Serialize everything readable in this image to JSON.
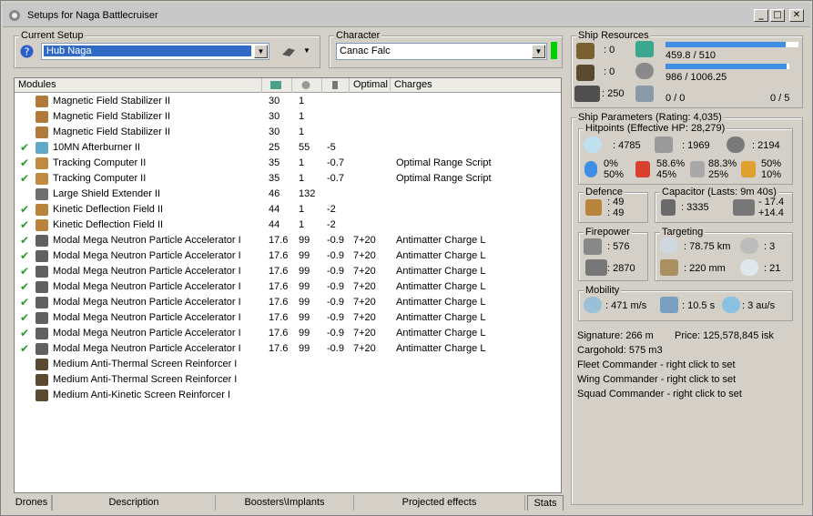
{
  "window": {
    "title": "Setups for Naga Battlecruiser",
    "min": "_",
    "max": "□",
    "close": "✕"
  },
  "setup": {
    "legend": "Current Setup",
    "value": "Hub Naga"
  },
  "character": {
    "legend": "Character",
    "value": "Canac Falc",
    "status_color": "#00d000"
  },
  "columns": {
    "modules": "Modules",
    "optimal": "Optimal",
    "charges": "Charges"
  },
  "modules": [
    {
      "check": "",
      "name": "Magnetic Field Stabilizer II",
      "cpu": "30",
      "pg": "1",
      "cap": "",
      "opt": "",
      "charge": "",
      "icon": "#b07a3a"
    },
    {
      "check": "",
      "name": "Magnetic Field Stabilizer II",
      "cpu": "30",
      "pg": "1",
      "cap": "",
      "opt": "",
      "charge": "",
      "icon": "#b07a3a"
    },
    {
      "check": "",
      "name": "Magnetic Field Stabilizer II",
      "cpu": "30",
      "pg": "1",
      "cap": "",
      "opt": "",
      "charge": "",
      "icon": "#b07a3a"
    },
    {
      "check": "✔",
      "name": "10MN Afterburner II",
      "cpu": "25",
      "pg": "55",
      "cap": "-5",
      "opt": "",
      "charge": "",
      "icon": "#5fa8c8"
    },
    {
      "check": "✔",
      "name": "Tracking Computer II",
      "cpu": "35",
      "pg": "1",
      "cap": "-0.7",
      "opt": "",
      "charge": "Optimal Range Script",
      "icon": "#c08a40"
    },
    {
      "check": "✔",
      "name": "Tracking Computer II",
      "cpu": "35",
      "pg": "1",
      "cap": "-0.7",
      "opt": "",
      "charge": "Optimal Range Script",
      "icon": "#c08a40"
    },
    {
      "check": "",
      "name": "Large Shield Extender II",
      "cpu": "46",
      "pg": "132",
      "cap": "",
      "opt": "",
      "charge": "",
      "icon": "#707070"
    },
    {
      "check": "✔",
      "name": "Kinetic Deflection Field II",
      "cpu": "44",
      "pg": "1",
      "cap": "-2",
      "opt": "",
      "charge": "",
      "icon": "#b8843c"
    },
    {
      "check": "✔",
      "name": "Kinetic Deflection Field II",
      "cpu": "44",
      "pg": "1",
      "cap": "-2",
      "opt": "",
      "charge": "",
      "icon": "#b8843c"
    },
    {
      "check": "✔",
      "name": "Modal Mega Neutron Particle Accelerator I",
      "cpu": "17.6",
      "pg": "99",
      "cap": "-0.9",
      "opt": "7+20",
      "charge": "Antimatter Charge L",
      "icon": "#606060"
    },
    {
      "check": "✔",
      "name": "Modal Mega Neutron Particle Accelerator I",
      "cpu": "17.6",
      "pg": "99",
      "cap": "-0.9",
      "opt": "7+20",
      "charge": "Antimatter Charge L",
      "icon": "#606060"
    },
    {
      "check": "✔",
      "name": "Modal Mega Neutron Particle Accelerator I",
      "cpu": "17.6",
      "pg": "99",
      "cap": "-0.9",
      "opt": "7+20",
      "charge": "Antimatter Charge L",
      "icon": "#606060"
    },
    {
      "check": "✔",
      "name": "Modal Mega Neutron Particle Accelerator I",
      "cpu": "17.6",
      "pg": "99",
      "cap": "-0.9",
      "opt": "7+20",
      "charge": "Antimatter Charge L",
      "icon": "#606060"
    },
    {
      "check": "✔",
      "name": "Modal Mega Neutron Particle Accelerator I",
      "cpu": "17.6",
      "pg": "99",
      "cap": "-0.9",
      "opt": "7+20",
      "charge": "Antimatter Charge L",
      "icon": "#606060"
    },
    {
      "check": "✔",
      "name": "Modal Mega Neutron Particle Accelerator I",
      "cpu": "17.6",
      "pg": "99",
      "cap": "-0.9",
      "opt": "7+20",
      "charge": "Antimatter Charge L",
      "icon": "#606060"
    },
    {
      "check": "✔",
      "name": "Modal Mega Neutron Particle Accelerator I",
      "cpu": "17.6",
      "pg": "99",
      "cap": "-0.9",
      "opt": "7+20",
      "charge": "Antimatter Charge L",
      "icon": "#606060"
    },
    {
      "check": "✔",
      "name": "Modal Mega Neutron Particle Accelerator I",
      "cpu": "17.6",
      "pg": "99",
      "cap": "-0.9",
      "opt": "7+20",
      "charge": "Antimatter Charge L",
      "icon": "#606060"
    },
    {
      "check": "",
      "name": "Medium Anti-Thermal Screen Reinforcer I",
      "cpu": "",
      "pg": "",
      "cap": "",
      "opt": "",
      "charge": "",
      "icon": "#5a4a30"
    },
    {
      "check": "",
      "name": "Medium Anti-Thermal Screen Reinforcer I",
      "cpu": "",
      "pg": "",
      "cap": "",
      "opt": "",
      "charge": "",
      "icon": "#5a4a30"
    },
    {
      "check": "",
      "name": "Medium Anti-Kinetic Screen Reinforcer I",
      "cpu": "",
      "pg": "",
      "cap": "",
      "opt": "",
      "charge": "",
      "icon": "#5a4a30"
    }
  ],
  "tabs": {
    "drones": "Drones",
    "description": "Description",
    "boosters": "Boosters\\Implants",
    "projected": "Projected effects",
    "stats": "Stats"
  },
  "resources": {
    "legend": "Ship Resources",
    "high": ": 0",
    "med": ": 0",
    "low": ": 250",
    "cpu": "459.8 / 510",
    "cpu_frac": 0.902,
    "pg": "986 / 1006.25",
    "pg_frac": 0.98,
    "calib": "0 / 0",
    "rigs": "0 / 5"
  },
  "params": {
    "legend": "Ship Parameters (Rating: 4,035)",
    "hp_legend": "Hitpoints (Effective HP: 28,279)",
    "shield_hp": ": 4785",
    "armor_hp": ": 1969",
    "hull_hp": ": 2194",
    "sh_res_a": "0%",
    "sh_res_b": "50%",
    "ar_res_a": "58.6%",
    "ar_res_b": "45%",
    "hu_res_a": "88.3%",
    "hu_res_b": "25%",
    "ex_res_a": "50%",
    "ex_res_b": "10%",
    "defence_legend": "Defence",
    "def_a": ": 49",
    "def_b": ": 49",
    "cap_legend": "Capacitor (Lasts: 9m 40s)",
    "cap_amount": ": 3335",
    "cap_a": "- 17.4",
    "cap_b": "+14.4",
    "fire_legend": "Firepower",
    "dps": ": 576",
    "volley": ": 2870",
    "target_legend": "Targeting",
    "range": ": 78.75 km",
    "targets": ": 3",
    "scan": ": 220 mm",
    "sensor": ": 21",
    "mob_legend": "Mobility",
    "speed": ": 471 m/s",
    "align": ": 10.5 s",
    "warp": ": 3 au/s",
    "signature": "Signature: 266 m",
    "price": "Price: 125,578,845 isk",
    "cargo": "Cargohold: 575 m3",
    "fleet": "Fleet Commander - right click to set",
    "wing": "Wing Commander - right click to set",
    "squad": "Squad Commander - right click to set"
  }
}
